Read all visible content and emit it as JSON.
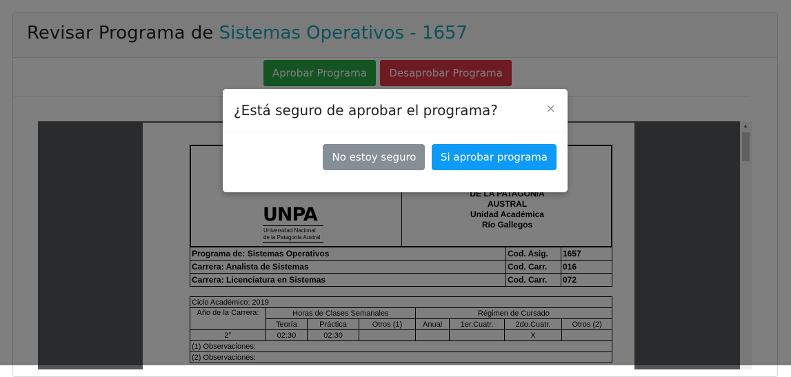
{
  "page": {
    "title_prefix": "Revisar Programa de ",
    "title_subject": "Sistemas Operativos - 1657",
    "approve_label": "Aprobar Programa",
    "reject_label": "Desaprobar Programa"
  },
  "document": {
    "university_lines": [
      "DE LA PATAGONIA",
      "AUSTRAL",
      "Unidad Académica",
      "Río Gallegos"
    ],
    "logo_text": "UNPA",
    "logo_sub": [
      "Universidad Nacional",
      "de la Patagonia Austral"
    ],
    "rows": [
      {
        "label": "Programa de: Sistemas Operativos",
        "code_label": "Cod. Asig.",
        "code": "1657"
      },
      {
        "label": "Carrera: Analista de Sistemas",
        "code_label": "Cod. Carr.",
        "code": "016"
      },
      {
        "label": "Carrera: Licenciatura en Sistemas",
        "code_label": "Cod. Carr.",
        "code": "072"
      }
    ],
    "ciclo": "Ciclo Académico: 2019",
    "anio_label": "Año de la Carrera:",
    "horas_label": "Horas de Clases Semanales",
    "regimen_label": "Régimen de Cursado",
    "sub_headers": [
      "Teoría",
      "Práctica",
      "Otros (1)",
      "Anual",
      "1er.Cuatr.",
      "2do.Cuatr.",
      "Otros (2)"
    ],
    "values": [
      "2°",
      "02:30",
      "02:30",
      "",
      "",
      "",
      "X",
      ""
    ],
    "obs1": "(1) Observaciones:",
    "obs2": "(2) Observaciones:"
  },
  "modal": {
    "title": "¿Está seguro de aprobar el programa?",
    "close_glyph": "×",
    "cancel_label": "No estoy seguro",
    "confirm_label": "Si aprobar programa"
  },
  "colors": {
    "accent": "#17a2b8",
    "approve": "#28a745",
    "reject": "#dc3545",
    "confirm": "#0d9bf7",
    "cancel": "#868e96"
  }
}
